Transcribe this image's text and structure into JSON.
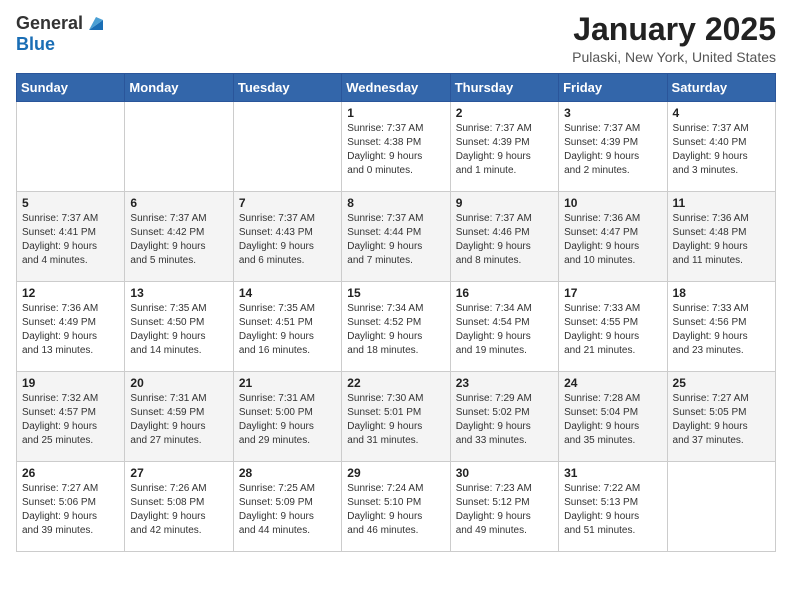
{
  "header": {
    "logo_general": "General",
    "logo_blue": "Blue",
    "month": "January 2025",
    "location": "Pulaski, New York, United States"
  },
  "days_of_week": [
    "Sunday",
    "Monday",
    "Tuesday",
    "Wednesday",
    "Thursday",
    "Friday",
    "Saturday"
  ],
  "weeks": [
    [
      {
        "day": "",
        "info": ""
      },
      {
        "day": "",
        "info": ""
      },
      {
        "day": "",
        "info": ""
      },
      {
        "day": "1",
        "info": "Sunrise: 7:37 AM\nSunset: 4:38 PM\nDaylight: 9 hours\nand 0 minutes."
      },
      {
        "day": "2",
        "info": "Sunrise: 7:37 AM\nSunset: 4:39 PM\nDaylight: 9 hours\nand 1 minute."
      },
      {
        "day": "3",
        "info": "Sunrise: 7:37 AM\nSunset: 4:39 PM\nDaylight: 9 hours\nand 2 minutes."
      },
      {
        "day": "4",
        "info": "Sunrise: 7:37 AM\nSunset: 4:40 PM\nDaylight: 9 hours\nand 3 minutes."
      }
    ],
    [
      {
        "day": "5",
        "info": "Sunrise: 7:37 AM\nSunset: 4:41 PM\nDaylight: 9 hours\nand 4 minutes."
      },
      {
        "day": "6",
        "info": "Sunrise: 7:37 AM\nSunset: 4:42 PM\nDaylight: 9 hours\nand 5 minutes."
      },
      {
        "day": "7",
        "info": "Sunrise: 7:37 AM\nSunset: 4:43 PM\nDaylight: 9 hours\nand 6 minutes."
      },
      {
        "day": "8",
        "info": "Sunrise: 7:37 AM\nSunset: 4:44 PM\nDaylight: 9 hours\nand 7 minutes."
      },
      {
        "day": "9",
        "info": "Sunrise: 7:37 AM\nSunset: 4:46 PM\nDaylight: 9 hours\nand 8 minutes."
      },
      {
        "day": "10",
        "info": "Sunrise: 7:36 AM\nSunset: 4:47 PM\nDaylight: 9 hours\nand 10 minutes."
      },
      {
        "day": "11",
        "info": "Sunrise: 7:36 AM\nSunset: 4:48 PM\nDaylight: 9 hours\nand 11 minutes."
      }
    ],
    [
      {
        "day": "12",
        "info": "Sunrise: 7:36 AM\nSunset: 4:49 PM\nDaylight: 9 hours\nand 13 minutes."
      },
      {
        "day": "13",
        "info": "Sunrise: 7:35 AM\nSunset: 4:50 PM\nDaylight: 9 hours\nand 14 minutes."
      },
      {
        "day": "14",
        "info": "Sunrise: 7:35 AM\nSunset: 4:51 PM\nDaylight: 9 hours\nand 16 minutes."
      },
      {
        "day": "15",
        "info": "Sunrise: 7:34 AM\nSunset: 4:52 PM\nDaylight: 9 hours\nand 18 minutes."
      },
      {
        "day": "16",
        "info": "Sunrise: 7:34 AM\nSunset: 4:54 PM\nDaylight: 9 hours\nand 19 minutes."
      },
      {
        "day": "17",
        "info": "Sunrise: 7:33 AM\nSunset: 4:55 PM\nDaylight: 9 hours\nand 21 minutes."
      },
      {
        "day": "18",
        "info": "Sunrise: 7:33 AM\nSunset: 4:56 PM\nDaylight: 9 hours\nand 23 minutes."
      }
    ],
    [
      {
        "day": "19",
        "info": "Sunrise: 7:32 AM\nSunset: 4:57 PM\nDaylight: 9 hours\nand 25 minutes."
      },
      {
        "day": "20",
        "info": "Sunrise: 7:31 AM\nSunset: 4:59 PM\nDaylight: 9 hours\nand 27 minutes."
      },
      {
        "day": "21",
        "info": "Sunrise: 7:31 AM\nSunset: 5:00 PM\nDaylight: 9 hours\nand 29 minutes."
      },
      {
        "day": "22",
        "info": "Sunrise: 7:30 AM\nSunset: 5:01 PM\nDaylight: 9 hours\nand 31 minutes."
      },
      {
        "day": "23",
        "info": "Sunrise: 7:29 AM\nSunset: 5:02 PM\nDaylight: 9 hours\nand 33 minutes."
      },
      {
        "day": "24",
        "info": "Sunrise: 7:28 AM\nSunset: 5:04 PM\nDaylight: 9 hours\nand 35 minutes."
      },
      {
        "day": "25",
        "info": "Sunrise: 7:27 AM\nSunset: 5:05 PM\nDaylight: 9 hours\nand 37 minutes."
      }
    ],
    [
      {
        "day": "26",
        "info": "Sunrise: 7:27 AM\nSunset: 5:06 PM\nDaylight: 9 hours\nand 39 minutes."
      },
      {
        "day": "27",
        "info": "Sunrise: 7:26 AM\nSunset: 5:08 PM\nDaylight: 9 hours\nand 42 minutes."
      },
      {
        "day": "28",
        "info": "Sunrise: 7:25 AM\nSunset: 5:09 PM\nDaylight: 9 hours\nand 44 minutes."
      },
      {
        "day": "29",
        "info": "Sunrise: 7:24 AM\nSunset: 5:10 PM\nDaylight: 9 hours\nand 46 minutes."
      },
      {
        "day": "30",
        "info": "Sunrise: 7:23 AM\nSunset: 5:12 PM\nDaylight: 9 hours\nand 49 minutes."
      },
      {
        "day": "31",
        "info": "Sunrise: 7:22 AM\nSunset: 5:13 PM\nDaylight: 9 hours\nand 51 minutes."
      },
      {
        "day": "",
        "info": ""
      }
    ]
  ]
}
